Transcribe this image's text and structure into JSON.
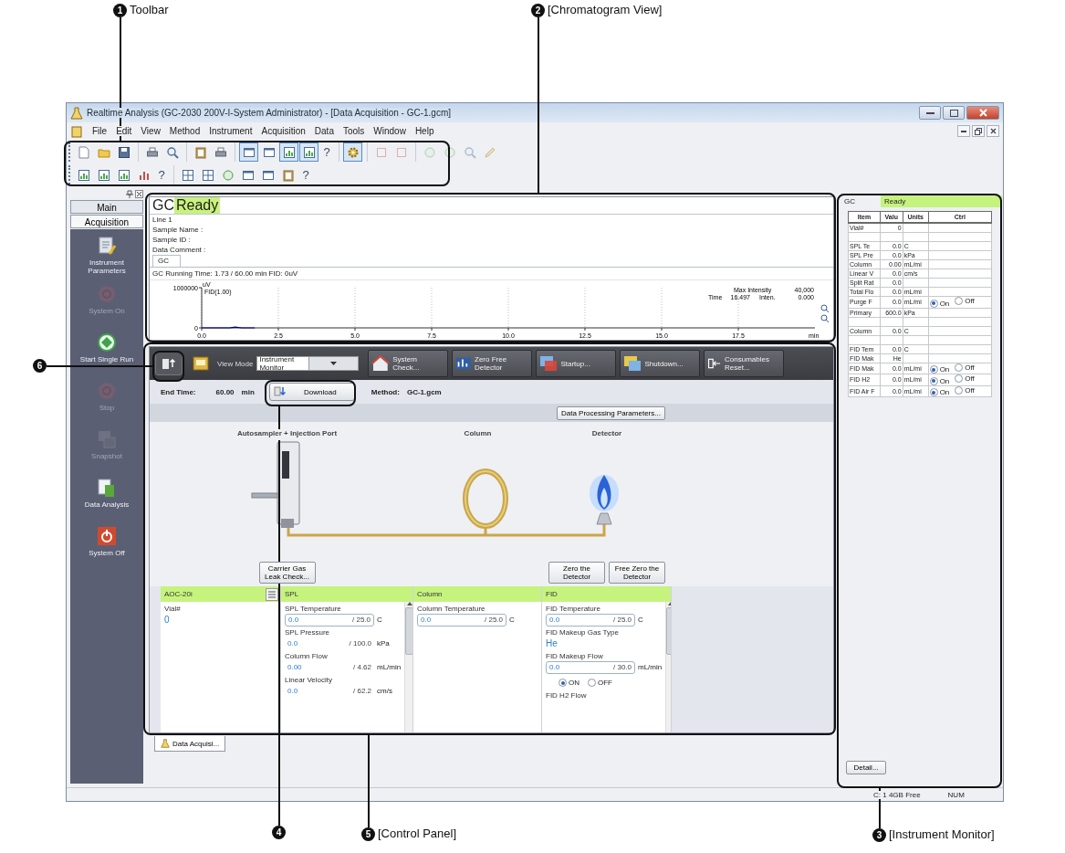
{
  "callouts": [
    {
      "number": "1",
      "label": "Toolbar"
    },
    {
      "number": "2",
      "label": "[Chromatogram View]"
    },
    {
      "number": "6"
    },
    {
      "number": "4"
    },
    {
      "number": "5",
      "label": "[Control Panel]"
    },
    {
      "number": "3",
      "label": "[Instrument Monitor]"
    }
  ],
  "window": {
    "title": "Realtime Analysis (GC-2030 200V-I-System Administrator) - [Data Acquisition - GC-1.gcm]"
  },
  "menu": [
    "File",
    "Edit",
    "View",
    "Method",
    "Instrument",
    "Acquisition",
    "Data",
    "Tools",
    "Window",
    "Help"
  ],
  "toolbar": {
    "rows": [
      [
        [
          {
            "kind": "button",
            "pressed": false,
            "disabled": false
          },
          {
            "kind": "button",
            "pressed": false,
            "disabled": false
          },
          {
            "kind": "button",
            "pressed": false,
            "disabled": false
          }
        ],
        [
          {
            "kind": "button",
            "pressed": false,
            "disabled": false
          },
          {
            "kind": "button",
            "pressed": false,
            "disabled": false
          }
        ],
        [
          {
            "kind": "button",
            "pressed": false,
            "disabled": false
          },
          {
            "kind": "button",
            "pressed": false,
            "disabled": false
          }
        ],
        [
          {
            "kind": "button",
            "pressed": true,
            "disabled": false
          },
          {
            "kind": "button",
            "pressed": false,
            "disabled": false
          },
          {
            "kind": "button",
            "pressed": true,
            "disabled": false
          },
          {
            "kind": "button",
            "pressed": true,
            "disabled": false
          },
          {
            "kind": "help",
            "label": "?"
          }
        ],
        [
          {
            "kind": "button",
            "pressed": true,
            "disabled": false
          }
        ],
        [
          {
            "kind": "button",
            "pressed": false,
            "disabled": true
          },
          {
            "kind": "button",
            "pressed": false,
            "disabled": true
          }
        ],
        [
          {
            "kind": "button",
            "pressed": false,
            "disabled": true
          },
          {
            "kind": "button",
            "pressed": false,
            "disabled": true
          },
          {
            "kind": "button",
            "pressed": false,
            "disabled": true
          },
          {
            "kind": "button",
            "pressed": false,
            "disabled": true
          }
        ]
      ],
      [
        [
          {
            "kind": "button",
            "pressed": false,
            "disabled": false
          },
          {
            "kind": "button",
            "pressed": false,
            "disabled": false
          },
          {
            "kind": "button",
            "pressed": false,
            "disabled": false
          },
          {
            "kind": "button",
            "pressed": false,
            "disabled": false
          },
          {
            "kind": "help",
            "label": "?"
          }
        ],
        [
          {
            "kind": "button",
            "pressed": false,
            "disabled": false
          },
          {
            "kind": "button",
            "pressed": false,
            "disabled": false
          },
          {
            "kind": "button",
            "pressed": false,
            "disabled": false
          },
          {
            "kind": "button",
            "pressed": false,
            "disabled": false
          },
          {
            "kind": "button",
            "pressed": false,
            "disabled": false
          },
          {
            "kind": "button",
            "pressed": false,
            "disabled": false
          },
          {
            "kind": "help",
            "label": "?"
          }
        ]
      ]
    ]
  },
  "sidebar": {
    "tabs": [
      {
        "label": "Main",
        "selected": false
      },
      {
        "label": "Acquisition",
        "selected": true
      }
    ],
    "items": [
      {
        "label": "Instrument Parameters",
        "disabled": false
      },
      {
        "label": "System On",
        "disabled": true
      },
      {
        "label": "Start Single Run",
        "disabled": false
      },
      {
        "label": "Stop",
        "disabled": true
      },
      {
        "label": "Snapshot",
        "disabled": true
      },
      {
        "label": "Data Analysis",
        "disabled": false
      },
      {
        "label": "System Off",
        "disabled": false
      }
    ]
  },
  "chromatogram": {
    "instrument": "GC",
    "status": "Ready",
    "info": [
      "Line 1",
      "Sample Name :",
      "Sample ID :",
      "Data Comment :"
    ],
    "tab": "GC",
    "running": "GC Running Time: 1.73 / 60.00 min FID: 0uV",
    "max_intensity_label": "Max Intensity",
    "max_intensity": "40,000",
    "time_label": "Time",
    "time": "16.497",
    "inten_label": "Inten.",
    "inten": "0.000",
    "chart_data": {
      "type": "line",
      "grid": true,
      "xlabel": "min",
      "ylabel": "uV",
      "x": [
        0,
        0.5,
        0.9,
        1.1,
        1.3,
        1.73
      ],
      "series": [
        {
          "name": "FID(1.00)",
          "color": "#000080",
          "values": [
            0,
            0,
            0,
            20000,
            0,
            0
          ]
        }
      ],
      "xlim": [
        0,
        20
      ],
      "ylim": [
        0,
        1000000
      ],
      "xticks": [
        {
          "value": 0,
          "label": "0.0"
        },
        {
          "value": 2.5,
          "label": "2.5"
        },
        {
          "value": 5,
          "label": "5.0"
        },
        {
          "value": 7.5,
          "label": "7.5"
        },
        {
          "value": 10,
          "label": "10.0"
        },
        {
          "value": 12.5,
          "label": "12.5"
        },
        {
          "value": 15,
          "label": "15.0"
        },
        {
          "value": 17.5,
          "label": "17.5"
        }
      ],
      "yticks": [
        0,
        1000000
      ]
    }
  },
  "control_panel": {
    "view_mode_label": "View Mode",
    "view_mode": "Instrument Monitor",
    "tools": [
      "System Check...",
      "Zero Free Detector",
      "Startup...",
      "Shutdown...",
      "Consumables Reset..."
    ],
    "end_time_label": "End Time:",
    "end_time": "60.00",
    "end_time_unit": "min",
    "download": "Download",
    "method_label": "Method:",
    "method": "GC-1.gcm",
    "processing_button": "Data Processing Parameters...",
    "flow": [
      {
        "header": "Autosampler + Injection Port",
        "buttons": [
          "Carrier Gas Leak Check..."
        ]
      },
      {
        "header": "Column"
      },
      {
        "header": "Detector",
        "buttons": [
          "Zero the Detector",
          "Free Zero the Detector"
        ]
      }
    ],
    "panels": [
      {
        "title": "AOC-20i",
        "params": [
          {
            "kind": "reading",
            "name": "Vial#",
            "value": "0"
          }
        ]
      },
      {
        "title": "SPL",
        "params": [
          {
            "kind": "field",
            "name": "SPL Temperature",
            "value": "0.0",
            "setpoint": "/ 25.0",
            "unit": "C"
          },
          {
            "kind": "reading",
            "name": "SPL Pressure",
            "value": "0.0",
            "setpoint": "/ 100.0",
            "unit": "kPa"
          },
          {
            "kind": "reading",
            "name": "Column Flow",
            "value": "0.00",
            "setpoint": "/ 4.62",
            "unit": "mL/min"
          },
          {
            "kind": "reading",
            "name": "Linear Velocity",
            "value": "0.0",
            "setpoint": "/ 62.2",
            "unit": "cm/s"
          }
        ]
      },
      {
        "title": "Column",
        "params": [
          {
            "kind": "field",
            "name": "Column Temperature",
            "value": "0.0",
            "setpoint": "/ 25.0",
            "unit": "C"
          }
        ]
      },
      {
        "title": "FID",
        "params": [
          {
            "kind": "field",
            "name": "FID Temperature",
            "value": "0.0",
            "setpoint": "/ 25.0",
            "unit": "C"
          },
          {
            "kind": "reading",
            "name": "FID Makeup Gas Type",
            "value": "He"
          },
          {
            "kind": "field",
            "name": "FID Makeup Flow",
            "value": "0.0",
            "setpoint": "/ 30.0",
            "unit": "mL/min"
          },
          {
            "kind": "radio",
            "options": [
              {
                "label": "ON",
                "selected": true
              },
              {
                "label": "OFF",
                "selected": false
              }
            ]
          },
          {
            "kind": "label",
            "name": "FID H2 Flow"
          }
        ]
      }
    ]
  },
  "bottom_tab": "Data Acquisi...",
  "monitor": {
    "instrument": "GC",
    "status": "Ready",
    "columns": [
      "Item",
      "Valu",
      "Units",
      "Ctrl"
    ],
    "rows": [
      {
        "kind": "data",
        "item": "Vial#",
        "value": "0"
      },
      {
        "kind": "spacer"
      },
      {
        "kind": "data",
        "item": "SPL Te",
        "value": "0.0",
        "unit": "C"
      },
      {
        "kind": "data",
        "item": "SPL Pre",
        "value": "0.0",
        "unit": "kPa"
      },
      {
        "kind": "data",
        "item": "Column",
        "value": "0.00",
        "unit": "mL/mi"
      },
      {
        "kind": "data",
        "item": "Linear V",
        "value": "0.0",
        "unit": "cm/s"
      },
      {
        "kind": "data",
        "item": "Split Rat",
        "value": "0.0"
      },
      {
        "kind": "data",
        "item": "Total Flo",
        "value": "0.0",
        "unit": "mL/mi"
      },
      {
        "kind": "data",
        "item": "Purge F",
        "value": "0.0",
        "unit": "mL/mi",
        "ctrl": [
          {
            "label": "On",
            "selected": true
          },
          {
            "label": "Off",
            "selected": false
          }
        ]
      },
      {
        "kind": "data",
        "item": "Primary",
        "value": "600.0",
        "unit": "kPa"
      },
      {
        "kind": "spacer"
      },
      {
        "kind": "data",
        "item": "Column",
        "value": "0.0",
        "unit": "C"
      },
      {
        "kind": "spacer"
      },
      {
        "kind": "data",
        "item": "FID Tem",
        "value": "0.0",
        "unit": "C"
      },
      {
        "kind": "data",
        "item": "FID Mak",
        "value": "He"
      },
      {
        "kind": "data",
        "item": "FID Mak",
        "value": "0.0",
        "unit": "mL/mi",
        "ctrl": [
          {
            "label": "On",
            "selected": true
          },
          {
            "label": "Off",
            "selected": false
          }
        ]
      },
      {
        "kind": "data",
        "item": "FID H2",
        "value": "0.0",
        "unit": "mL/mi",
        "ctrl": [
          {
            "label": "On",
            "selected": true
          },
          {
            "label": "Off",
            "selected": false
          }
        ]
      },
      {
        "kind": "data",
        "item": "FID Air F",
        "value": "0.0",
        "unit": "mL/mi",
        "ctrl": [
          {
            "label": "On",
            "selected": true
          },
          {
            "label": "Off",
            "selected": false
          }
        ]
      }
    ],
    "detail_button": "Detail..."
  },
  "status_bar": [
    "C: 1 4GB Free",
    "NUM"
  ]
}
